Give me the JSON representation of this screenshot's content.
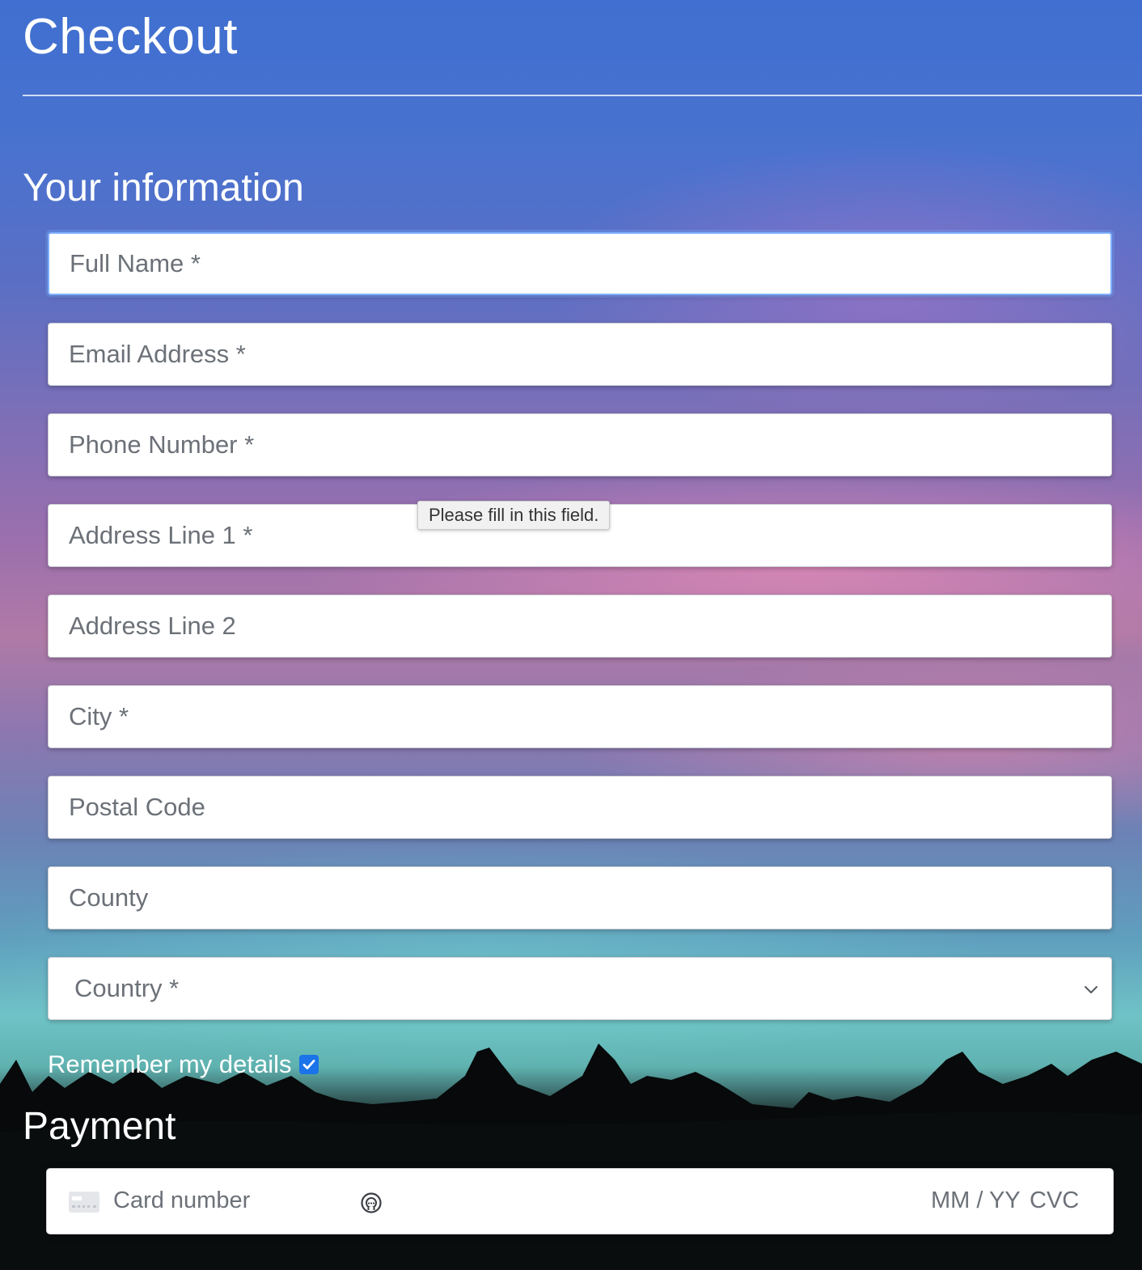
{
  "page": {
    "title": "Checkout"
  },
  "info_section": {
    "heading": "Your information",
    "fields": {
      "full_name": "Full Name *",
      "email": "Email Address *",
      "phone": "Phone Number *",
      "address1": "Address Line 1 *",
      "address2": "Address Line 2",
      "city": "City *",
      "postal_code": "Postal Code",
      "county": "County",
      "country": "Country *"
    },
    "validation_tooltip": "Please fill in this field.",
    "remember_label": "Remember my details",
    "remember_checked": true
  },
  "payment_section": {
    "heading": "Payment",
    "card_number_placeholder": "Card number",
    "expiry_placeholder": "MM / YY",
    "cvc_placeholder": "CVC"
  },
  "colors": {
    "focus_ring": "#7eaefc",
    "checkbox": "#1a73e8",
    "placeholder_text": "#6c7178"
  },
  "icons": {
    "card": "credit-card-icon",
    "link": "link-autofill-icon",
    "dropdown": "chevron-down-icon",
    "checkbox": "checkmark-icon"
  }
}
